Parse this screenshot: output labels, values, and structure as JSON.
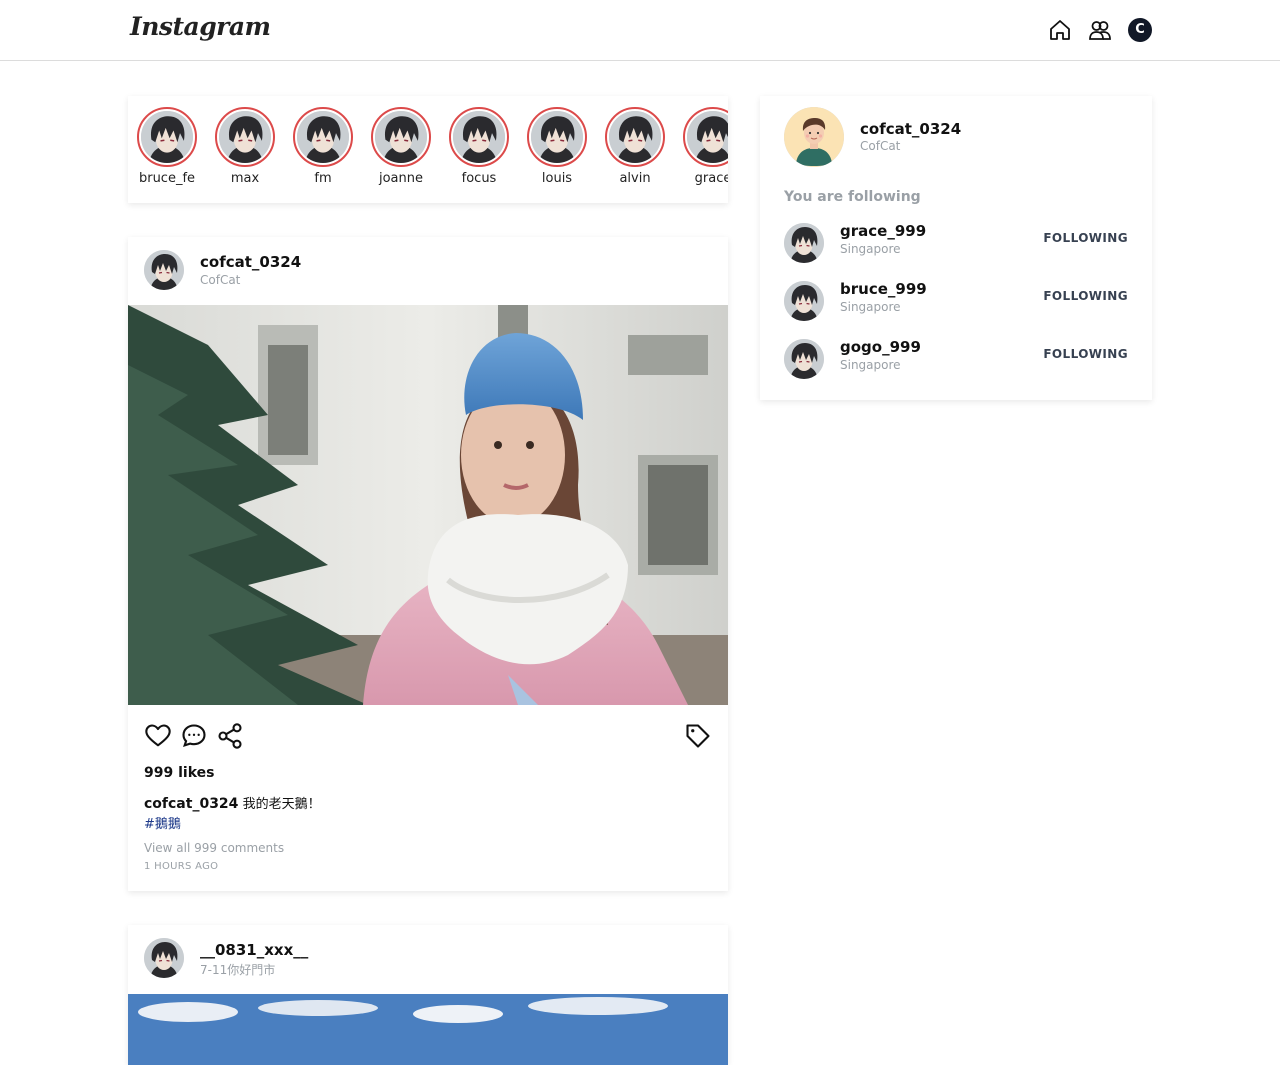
{
  "app": {
    "logo_text": "Instagram"
  },
  "nav": {
    "home_icon": "home-icon",
    "people_icon": "people-icon",
    "avatar_initial": "C"
  },
  "stories": [
    {
      "name": "bruce_fe"
    },
    {
      "name": "max"
    },
    {
      "name": "fm"
    },
    {
      "name": "joanne"
    },
    {
      "name": "focus"
    },
    {
      "name": "louis"
    },
    {
      "name": "alvin"
    },
    {
      "name": "grace"
    }
  ],
  "posts": [
    {
      "username": "cofcat_0324",
      "subtitle": "CofCat",
      "likes": "999 likes",
      "caption_user": "cofcat_0324",
      "caption_text": "我的老天鵝！",
      "hashtag": "#鵝鵝",
      "view_comments": "View all 999 comments",
      "time": "1 HOURS AGO"
    },
    {
      "username": "__0831_xxx__",
      "subtitle": "7-11你好門市"
    }
  ],
  "sidebar": {
    "me_name": "cofcat_0324",
    "me_sub": "CofCat",
    "following_title": "You are following",
    "following": [
      {
        "name": "grace_999",
        "location": "Singapore",
        "button": "FOLLOWING"
      },
      {
        "name": "bruce_999",
        "location": "Singapore",
        "button": "FOLLOWING"
      },
      {
        "name": "gogo_999",
        "location": "Singapore",
        "button": "FOLLOWING"
      }
    ]
  },
  "colors": {
    "story_ring": "#dc4a4a",
    "hashtag": "#1e3a8a",
    "muted": "#9aa0a6",
    "nav_avatar_bg": "#111827"
  }
}
